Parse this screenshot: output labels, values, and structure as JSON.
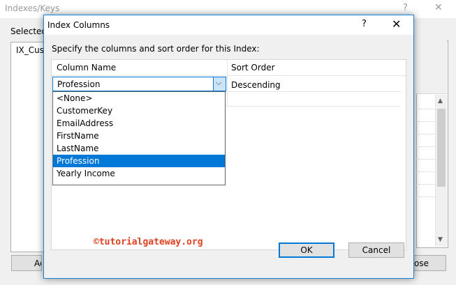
{
  "background_window": {
    "title": "Indexes/Keys",
    "help_glyph": "?",
    "close_glyph": "✕",
    "selected_label": "Selected",
    "list_item": "IX_Cust",
    "left_button_label": "Ad",
    "right_button_label": "ose"
  },
  "dialog": {
    "title": "Index Columns",
    "help_glyph": "?",
    "close_glyph": "✕",
    "instructions": "Specify the columns and sort order for this Index:",
    "columns": {
      "name": "Column Name",
      "sort": "Sort Order"
    },
    "row": {
      "column_name": "Profession",
      "sort_order": "Descending"
    },
    "dropdown_options": [
      "<None>",
      "CustomerKey",
      "EmailAddress",
      "FirstName",
      "LastName",
      "Profession",
      "Yearly Income"
    ],
    "selected_option": "Profession",
    "ok_label": "OK",
    "cancel_label": "Cancel",
    "watermark": "©tutorialgateway.org",
    "accent_color": "#0078d7"
  }
}
